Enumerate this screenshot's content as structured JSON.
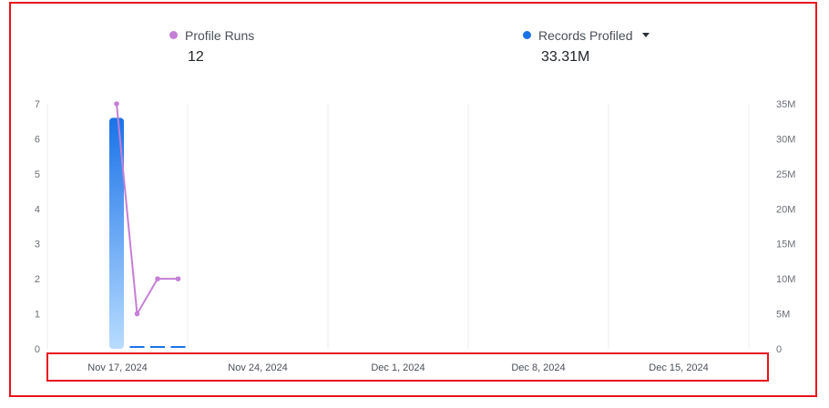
{
  "legend": {
    "profile_runs": {
      "label": "Profile Runs",
      "value": "12",
      "color": "#c57fd6"
    },
    "records_profiled": {
      "label": "Records Profiled",
      "value": "33.31M",
      "color": "#1a73e8"
    }
  },
  "chart_data": {
    "type": "bar",
    "categories": [
      "Nov 17, 2024",
      "Nov 24, 2024",
      "Dec 1, 2024",
      "Dec 8, 2024",
      "Dec 15, 2024"
    ],
    "left_axis": {
      "ticks": [
        "0",
        "1",
        "2",
        "3",
        "4",
        "5",
        "6",
        "7"
      ],
      "ylim": [
        0,
        7
      ]
    },
    "right_axis": {
      "ticks": [
        "0",
        "5M",
        "10M",
        "15M",
        "20M",
        "25M",
        "30M",
        "35M"
      ],
      "ylim": [
        0,
        35000000
      ]
    },
    "series": [
      {
        "name": "Records Profiled",
        "type": "bar",
        "axis": "right",
        "color": "#1a73e8",
        "points": [
          {
            "x": "Nov 17, 2024",
            "y": 33000000
          },
          {
            "x": "Nov 18, 2024",
            "y": 100000
          },
          {
            "x": "Nov 19, 2024",
            "y": 100000
          },
          {
            "x": "Nov 20, 2024",
            "y": 100000
          }
        ]
      },
      {
        "name": "Profile Runs",
        "type": "line",
        "axis": "left",
        "color": "#c57fd6",
        "points": [
          {
            "x": "Nov 17, 2024",
            "y": 7
          },
          {
            "x": "Nov 18, 2024",
            "y": 1
          },
          {
            "x": "Nov 19, 2024",
            "y": 2
          },
          {
            "x": "Nov 20, 2024",
            "y": 2
          }
        ]
      }
    ],
    "grid": true
  }
}
